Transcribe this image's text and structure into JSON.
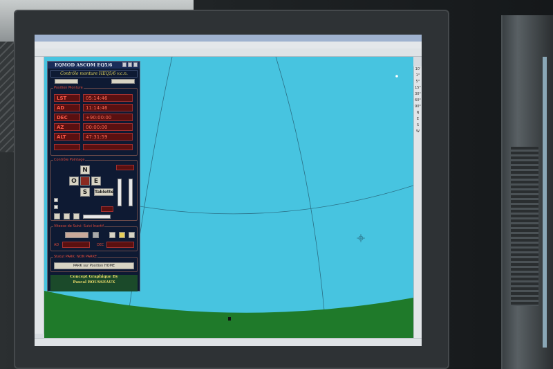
{
  "colors": {
    "sky": "#47c4e0",
    "ground": "#1f7a2a",
    "panel_bg": "#0e1a33",
    "value_red": "#ff5a4a"
  },
  "eqmod": {
    "title": "EQMOD ASCOM EQ5/6",
    "subtitle": "Contrôle monture HEQ5/6 v.c.n.",
    "position_section": "Position Monture",
    "rows": [
      {
        "label": "LST",
        "value": "05:14:46"
      },
      {
        "label": "AD",
        "value": "11:14:46"
      },
      {
        "label": "DEC",
        "value": "+90:00:00"
      },
      {
        "label": "AZ",
        "value": "00:00:00"
      },
      {
        "label": "ALT",
        "value": "47:31:59"
      }
    ],
    "pointing_section": "Contrôle Pointage",
    "directions": {
      "north": "N",
      "west": "O",
      "east": "E",
      "south": "S"
    },
    "tablette_label": "Tablette",
    "tracking_section": "Vitesse de Suivi: Suivi Inactif",
    "ad_label": "AD",
    "dec_label": "DEC",
    "park_section": "Statut PARK: NON PARKE",
    "park_button": "PARK sur Position HOME",
    "credit_lines": [
      "Concept Graphique By",
      "Pascal ROUSSEAUX"
    ]
  },
  "sidebar_right": [
    "10'",
    "1°",
    "5°",
    "15°",
    "30°",
    "60°",
    "90°",
    "N",
    "E",
    "S",
    "W"
  ],
  "icons": [
    "cursor-crosshair-icon",
    "star-icon"
  ]
}
